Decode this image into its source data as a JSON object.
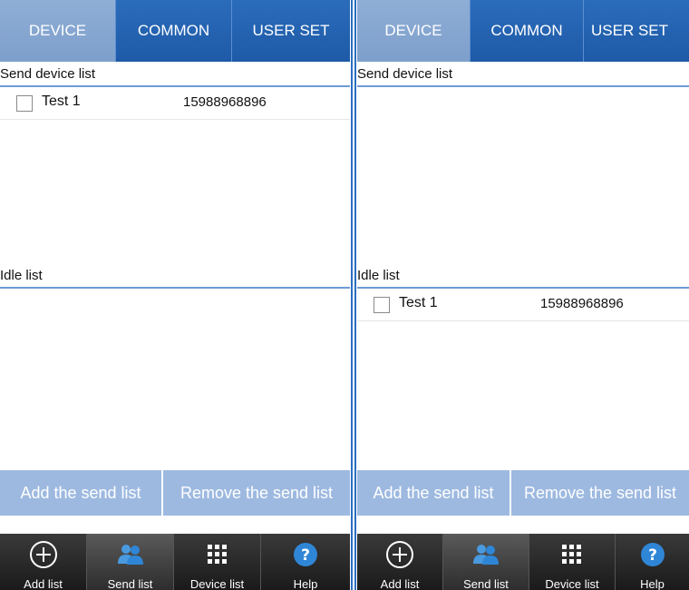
{
  "tabs": {
    "device": "DEVICE",
    "common": "COMMON",
    "user_set": "USER SET"
  },
  "sections": {
    "send_device_list": "Send device list",
    "idle_list": "Idle list"
  },
  "left_screen": {
    "send_list": [
      {
        "name": "Test 1",
        "number": "15988968896",
        "checked": false
      }
    ],
    "idle_list": []
  },
  "right_screen": {
    "send_list": [],
    "idle_list": [
      {
        "name": "Test 1",
        "number": "15988968896",
        "checked": false
      }
    ]
  },
  "actions": {
    "add": "Add the send list",
    "remove": "Remove the send list"
  },
  "bottom_nav": {
    "add_list": "Add list",
    "send_list": "Send list",
    "device_list": "Device list",
    "help": "Help"
  },
  "colors": {
    "tab_bar": "#1e5aa8",
    "tab_active": "#7e9fcb",
    "action_button": "#9db9e0",
    "bottom_nav": "#1a1a1a",
    "icon_blue": "#2f86d6"
  },
  "icons": {
    "add_list": "plus-circle-icon",
    "send_list": "people-icon",
    "device_list": "grid-icon",
    "help": "question-icon"
  }
}
